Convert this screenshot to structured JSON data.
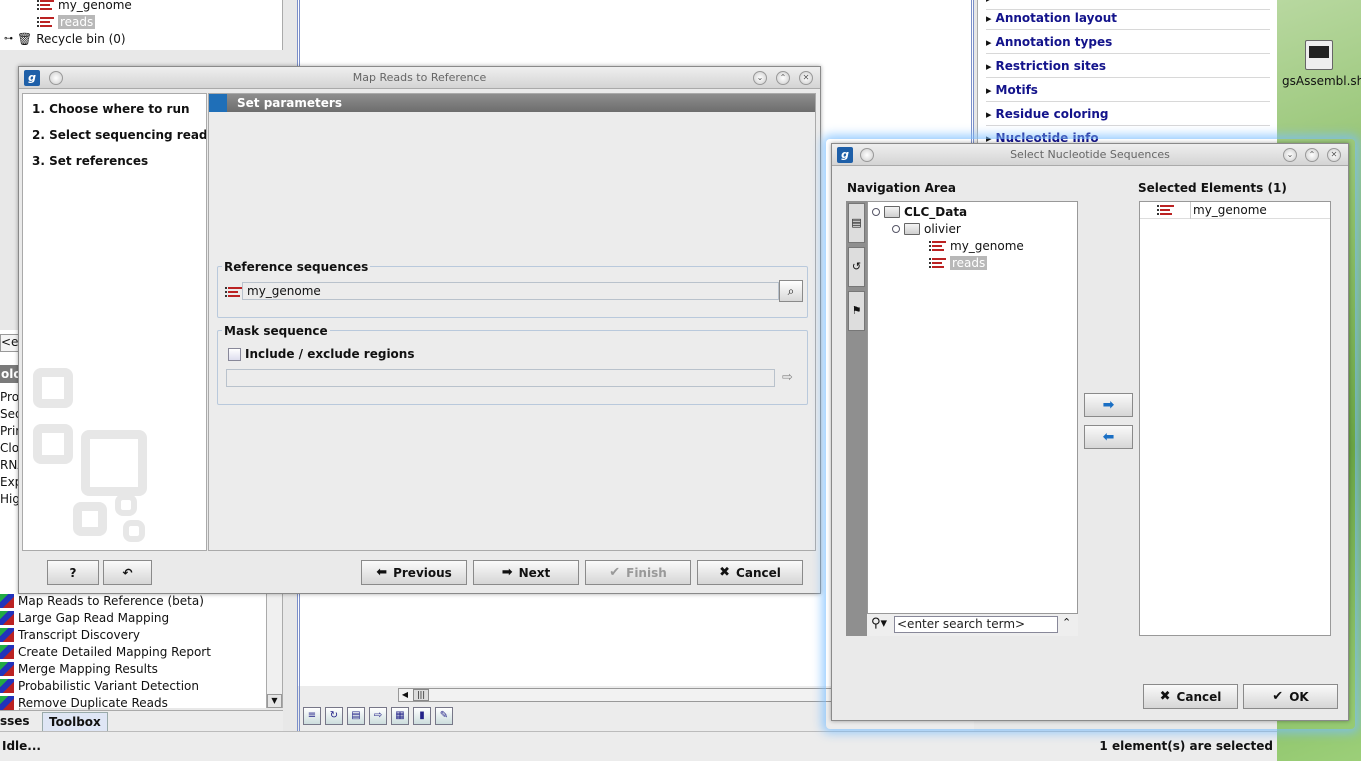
{
  "background": {
    "tree": {
      "item1": "my_genome",
      "item2": "reads",
      "recycle": "Recycle bin (0)"
    },
    "left_trunc": [
      "<e",
      "olo",
      "Prot",
      "Seq",
      "Prim",
      "Clon",
      "RNA",
      "Exp",
      "High"
    ],
    "toolbox": [
      "Map Reads to Reference (beta)",
      "Large Gap Read Mapping",
      "Transcript Discovery",
      "Create Detailed Mapping Report",
      "Merge Mapping Results",
      "Probabilistic Variant Detection",
      "Remove Duplicate Reads"
    ],
    "bottom_tabs": [
      "sses",
      "Toolbox"
    ],
    "side_panel": [
      "Annotation layout",
      "Annotation types",
      "Restriction sites",
      "Motifs",
      "Residue coloring",
      "Nucleotide info"
    ],
    "desktop_label": "gsAssembl.sh",
    "status_left": "Idle...",
    "status_right": "1 element(s) are selected"
  },
  "map_dialog": {
    "title": "Map Reads to Reference",
    "logo": "g",
    "steps": [
      "1.  Choose where to run",
      "2.  Select sequencing reads",
      "3.  Set references"
    ],
    "section": "Set parameters",
    "ref_group": "Reference sequences",
    "ref_value": "my_genome",
    "mask_group": "Mask sequence",
    "mask_checkbox": "Include / exclude regions",
    "buttons": {
      "help": "?",
      "reset": "↶",
      "previous": "Previous",
      "next": "Next",
      "finish": "Finish",
      "cancel": "Cancel"
    }
  },
  "select_dialog": {
    "title": "Select Nucleotide Sequences",
    "logo": "g",
    "nav_label": "Navigation Area",
    "selected_label": "Selected Elements (1)",
    "tree": {
      "root": "CLC_Data",
      "folder": "olivier",
      "item1": "my_genome",
      "item2": "reads"
    },
    "search_placeholder": "<enter search term>",
    "selected_items": [
      "my_genome"
    ],
    "buttons": {
      "cancel": "Cancel",
      "ok": "OK"
    }
  },
  "colors": {
    "accent": "#1f6fb8",
    "link": "#13138b",
    "glow": "#78beff",
    "sequence": "#b22222"
  }
}
